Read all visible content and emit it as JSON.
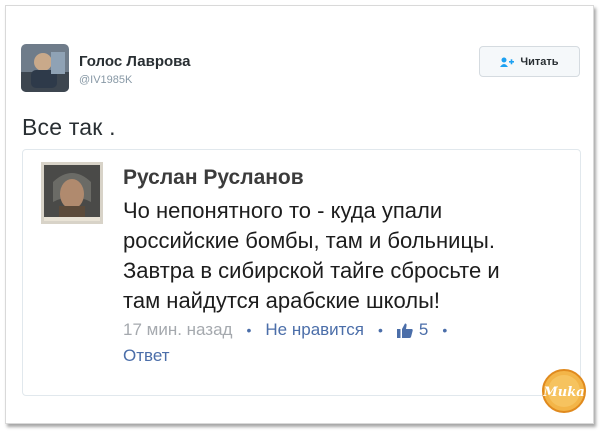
{
  "tweet": {
    "author_name": "Голос Лаврова",
    "author_handle": "@IV1985K",
    "follow_label": "Читать",
    "text": "Все так ."
  },
  "quoted_comment": {
    "commenter_name": "Руслан Русланов",
    "lines": [
      "Чо непонятного то - куда упали",
      "российские бомбы, там и больницы.",
      "Завтра в сибирской тайге сбросьте и",
      "там найдутся арабские школы!"
    ],
    "time_ago": "17 мин. назад",
    "separator": "•",
    "unlike_label": "Не нравится",
    "like_count": "5",
    "reply_label": "Ответ"
  },
  "watermark": {
    "text": "Muka"
  },
  "colors": {
    "link": "#4b6ea9",
    "twitter_blue": "#1da1f2",
    "watermark": "#f0a030"
  }
}
